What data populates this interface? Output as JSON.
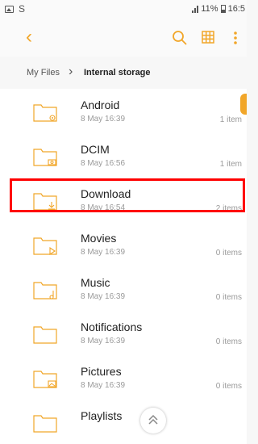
{
  "status": {
    "signal": ".ıl",
    "battery": "11%",
    "time": "16:5"
  },
  "breadcrumb": {
    "root": "My Files",
    "current": "Internal storage"
  },
  "files": [
    {
      "name": "Android",
      "date": "8 May 16:39",
      "count": "1 item",
      "badge": "settings"
    },
    {
      "name": "DCIM",
      "date": "8 May 16:56",
      "count": "1 item",
      "badge": "camera"
    },
    {
      "name": "Download",
      "date": "8 May 16:54",
      "count": "2 items",
      "badge": "download"
    },
    {
      "name": "Movies",
      "date": "8 May 16:39",
      "count": "0 items",
      "badge": "play"
    },
    {
      "name": "Music",
      "date": "8 May 16:39",
      "count": "0 items",
      "badge": "note"
    },
    {
      "name": "Notifications",
      "date": "8 May 16:39",
      "count": "0 items",
      "badge": ""
    },
    {
      "name": "Pictures",
      "date": "8 May 16:39",
      "count": "0 items",
      "badge": "image"
    },
    {
      "name": "Playlists",
      "date": "",
      "count": "",
      "badge": ""
    }
  ],
  "colors": {
    "accent": "#f1a629",
    "highlight": "#ff0000"
  }
}
